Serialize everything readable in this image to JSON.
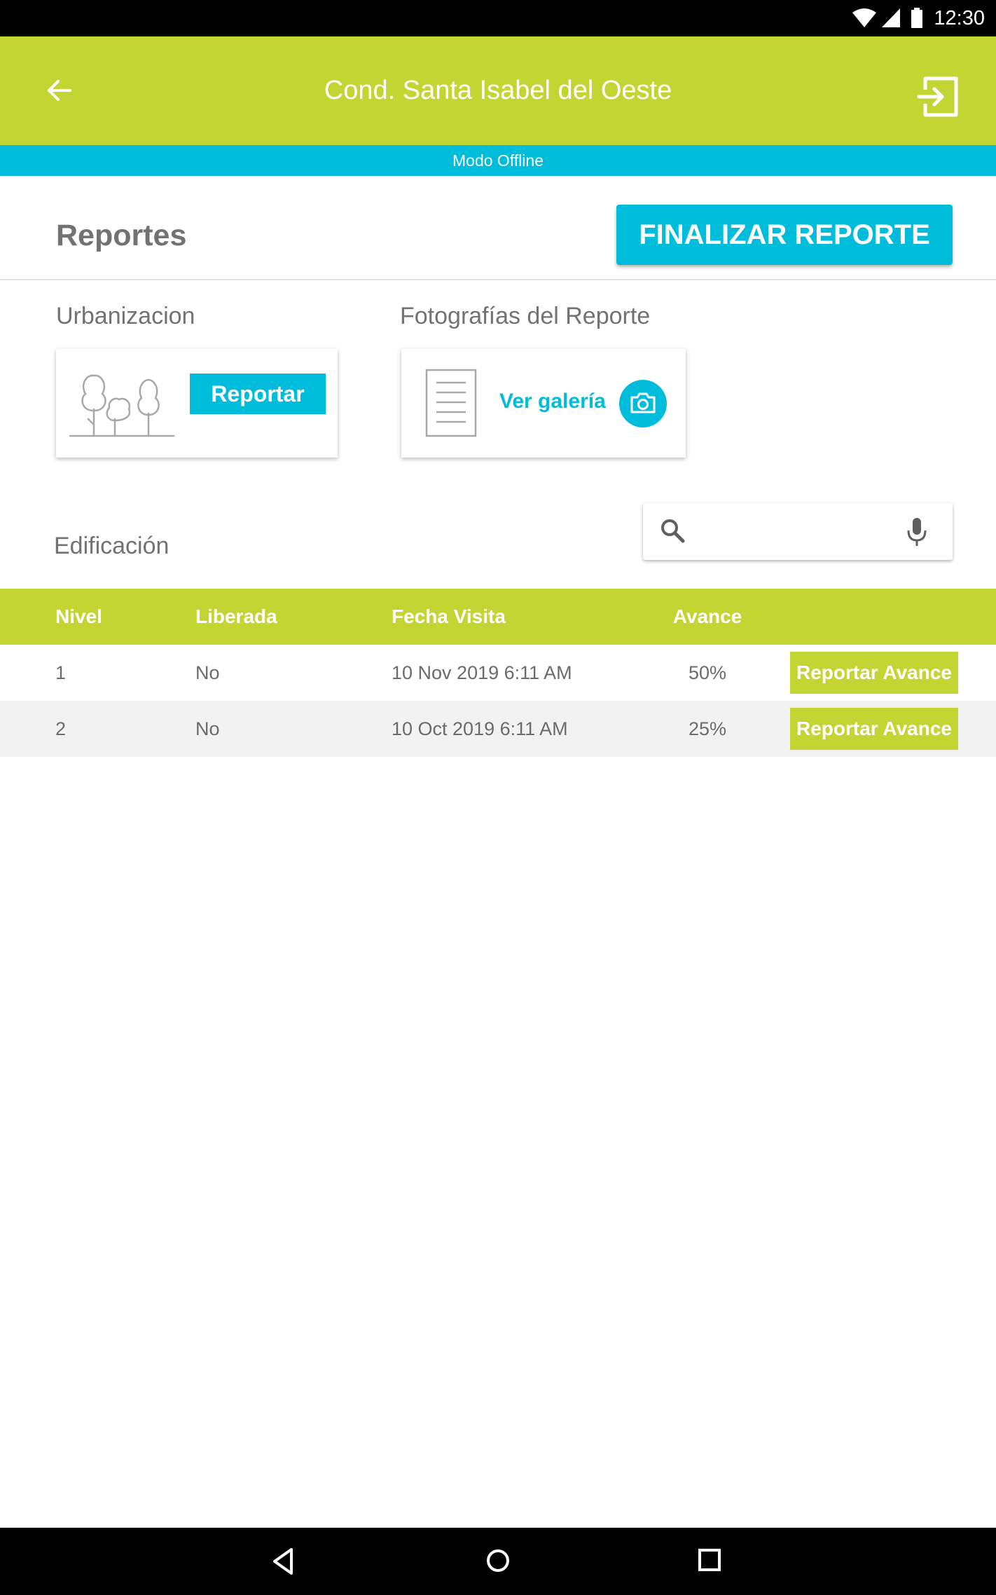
{
  "status_bar": {
    "time": "12:30"
  },
  "app_bar": {
    "title": "Cond. Santa Isabel del Oeste"
  },
  "offline_banner": "Modo Offline",
  "reportes": {
    "title": "Reportes",
    "finalizar_label": "FINALIZAR REPORTE"
  },
  "urbanizacion": {
    "label": "Urbanizacion",
    "reportar_label": "Reportar"
  },
  "fotografias": {
    "label": "Fotografías del Reporte",
    "gallery_label": "Ver galería"
  },
  "edificacion": {
    "label": "Edificación"
  },
  "search": {
    "placeholder": ""
  },
  "table": {
    "headers": [
      "Nivel",
      "Liberada",
      "Fecha Visita",
      "Avance"
    ],
    "rows": [
      {
        "nivel": "1",
        "liberada": "No",
        "fecha": "10 Nov 2019 6:11 AM",
        "avance": "50%",
        "action": "Reportar Avance"
      },
      {
        "nivel": "2",
        "liberada": "No",
        "fecha": "10 Oct 2019 6:11 AM",
        "avance": "25%",
        "action": "Reportar Avance"
      }
    ]
  },
  "colors": {
    "primary_green": "#c3d533",
    "accent_cyan": "#00bcdb",
    "label_gray": "#727272"
  },
  "icons": [
    "wifi-icon",
    "signal-icon",
    "battery-icon",
    "back-arrow-icon",
    "exit-icon",
    "trees-icon",
    "document-icon",
    "camera-icon",
    "search-icon",
    "microphone-icon",
    "nav-back-icon",
    "nav-home-icon",
    "nav-recents-icon"
  ]
}
